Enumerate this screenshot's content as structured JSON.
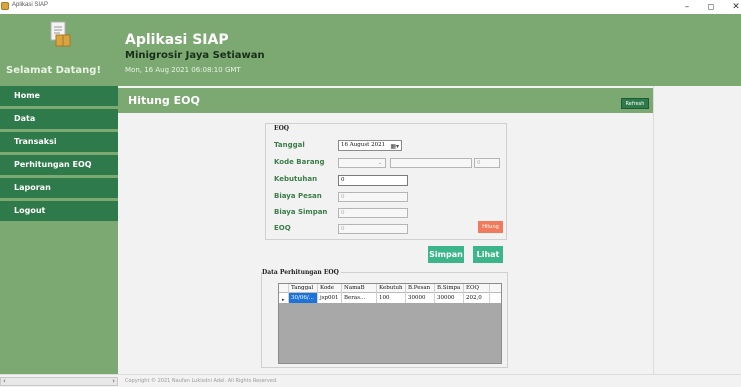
{
  "window": {
    "title": "Aplikasi SIAP",
    "controls": {
      "minimize": "–",
      "maximize": "◻",
      "close": "✕"
    }
  },
  "header": {
    "welcome": "Selamat Datang!",
    "app_title": "Aplikasi SIAP",
    "store_name": "Minigrosir Jaya Setiawan",
    "datetime": "Mon, 16 Aug 2021 06:08:10 GMT"
  },
  "sidebar": {
    "items": [
      {
        "label": "Home"
      },
      {
        "label": "Data"
      },
      {
        "label": "Transaksi"
      },
      {
        "label": "Perhitungan EOQ"
      },
      {
        "label": "Laporan"
      },
      {
        "label": "Logout"
      }
    ]
  },
  "page": {
    "title": "Hitung EOQ",
    "refresh_label": "Refresh"
  },
  "form": {
    "group_title": "EOQ",
    "tanggal": {
      "label": "Tanggal",
      "value": "16 August 2021"
    },
    "kode_barang": {
      "label": "Kode Barang",
      "value": "",
      "extra_value": "",
      "qty_value": "0"
    },
    "kebutuhan": {
      "label": "Kebutuhan",
      "value": "0"
    },
    "biaya_pesan": {
      "label": "Biaya Pesan",
      "value": "0"
    },
    "biaya_simpan": {
      "label": "Biaya Simpan",
      "value": "0"
    },
    "eoq": {
      "label": "EOQ",
      "value": "0"
    },
    "hitung_label": "Hitung",
    "simpan_label": "Simpan",
    "lihat_label": "Lihat"
  },
  "data_table": {
    "title": "Data Perhitungan EOQ",
    "columns": [
      "Tanggal",
      "Kode",
      "NamaB",
      "Kebutuh",
      "B.Pesan",
      "B.Simpa",
      "EOQ"
    ],
    "rows": [
      [
        "30/06/...",
        "jsp001",
        "Beras...",
        "100",
        "30000",
        "30000",
        "202,0"
      ]
    ]
  },
  "footer": {
    "copyright": "Copyright © 2021 Naufan Lukisdni Adel. All Rights Reserved."
  }
}
